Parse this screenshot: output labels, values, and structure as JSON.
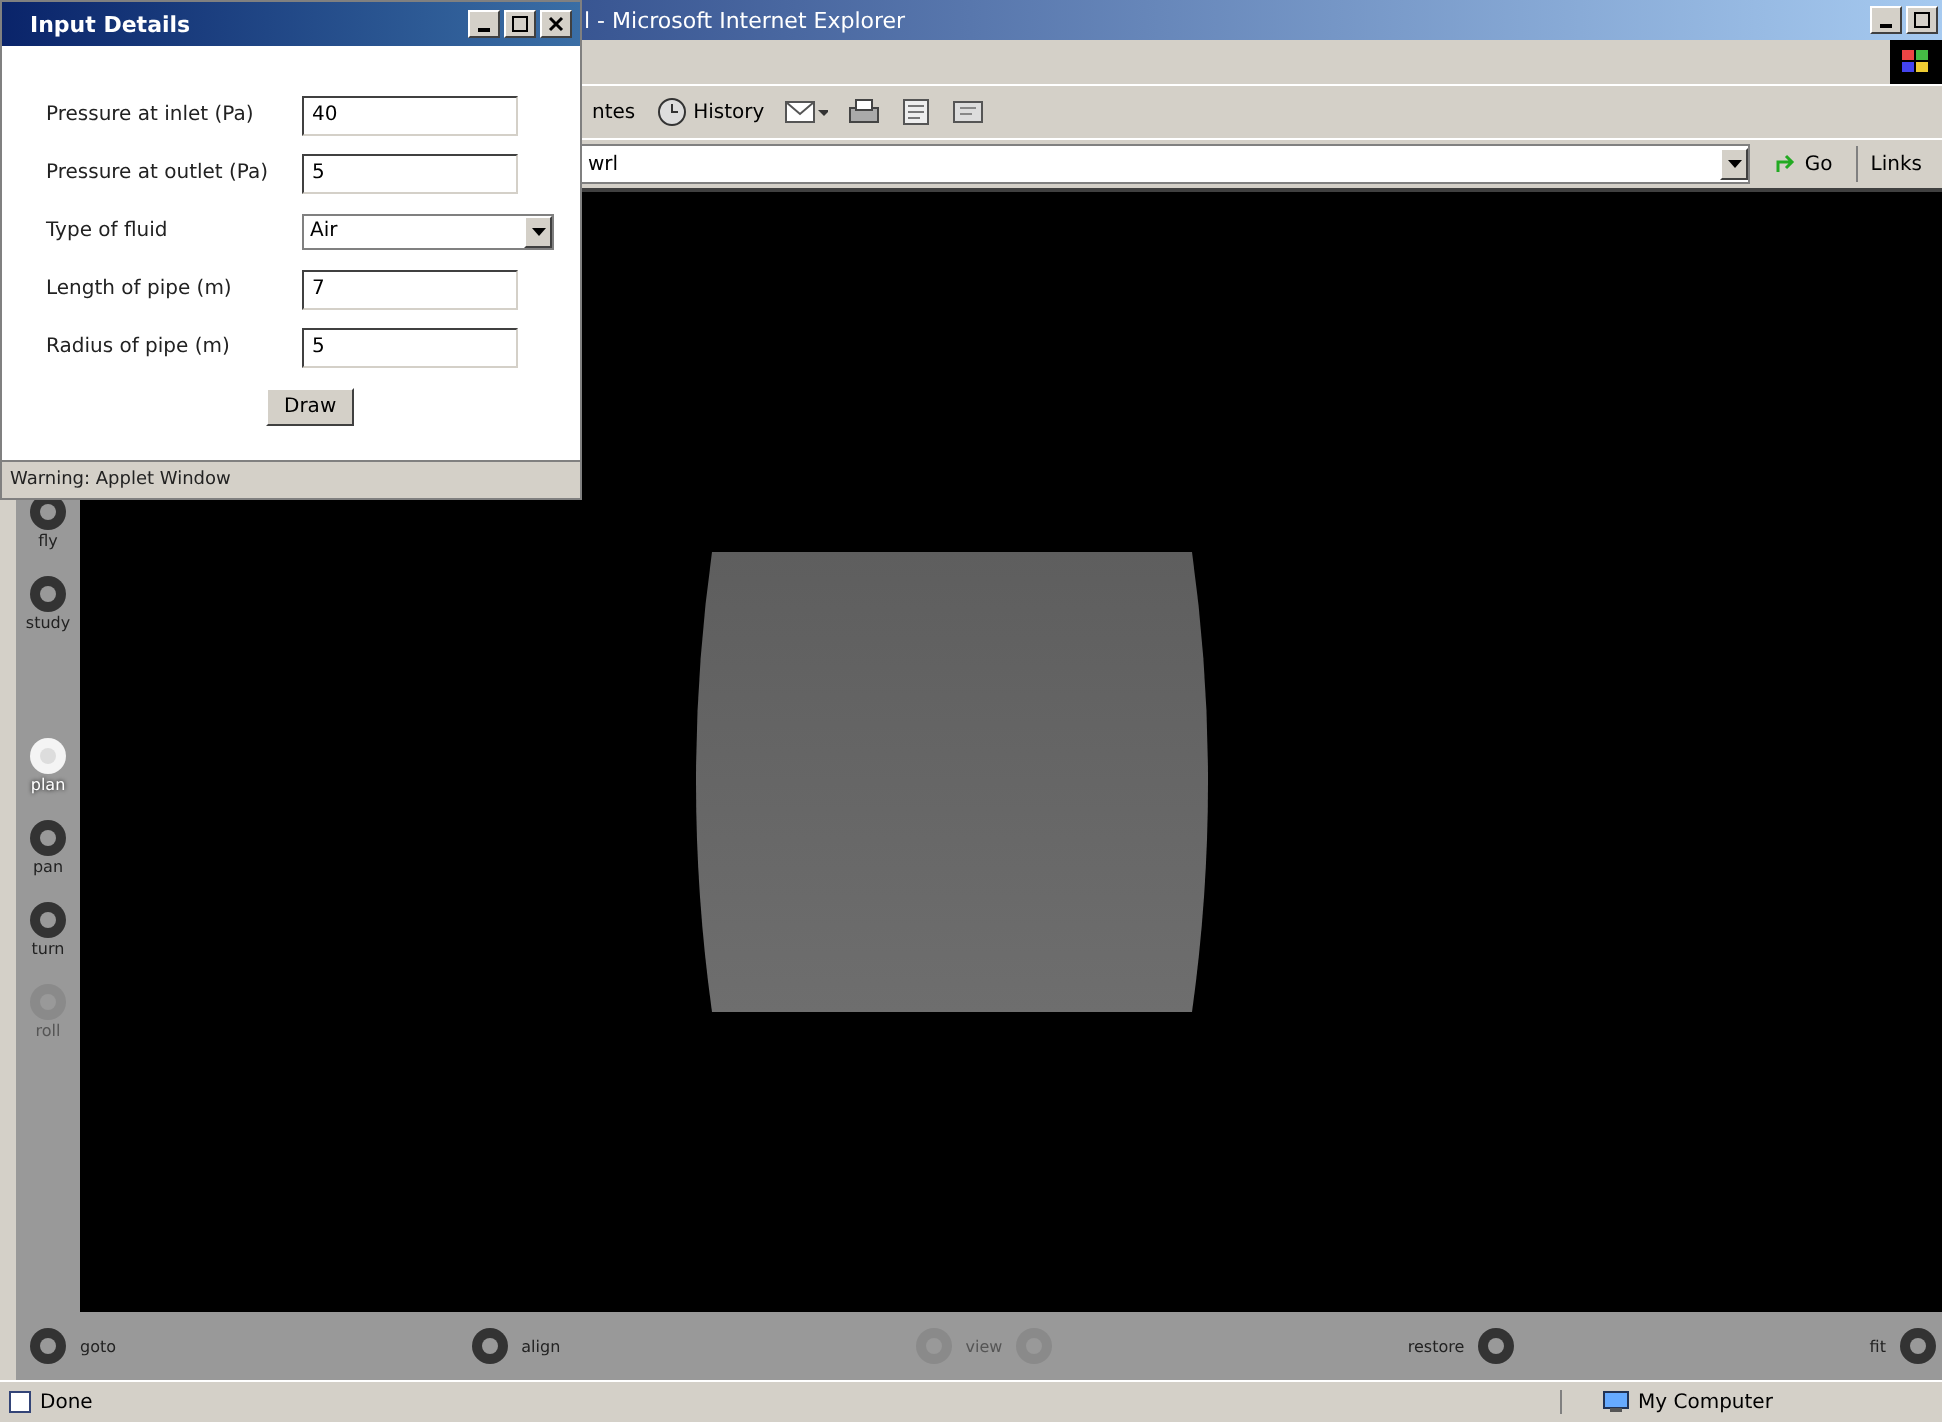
{
  "browser": {
    "title": "l - Microsoft Internet Explorer",
    "toolbar": [
      {
        "kind": "text",
        "label": "ntes"
      },
      {
        "kind": "history",
        "label": "History"
      }
    ],
    "address": "wrl",
    "go": "Go",
    "links": "Links"
  },
  "viewer": {
    "nav_buttons": [
      {
        "label": "fly",
        "selected": false,
        "disabled": false
      },
      {
        "label": "study",
        "selected": false,
        "disabled": false
      },
      {
        "label": "plan",
        "selected": true,
        "disabled": false
      },
      {
        "label": "pan",
        "selected": false,
        "disabled": false
      },
      {
        "label": "turn",
        "selected": false,
        "disabled": false
      },
      {
        "label": "roll",
        "selected": false,
        "disabled": true
      }
    ],
    "view_buttons": [
      {
        "label": "goto",
        "kind": "icon-left",
        "disabled": false
      },
      {
        "label": "align",
        "kind": "icon-left",
        "disabled": false
      },
      {
        "label": "view",
        "kind": "icons-both",
        "disabled": true
      },
      {
        "label": "restore",
        "kind": "icon-right",
        "disabled": false
      },
      {
        "label": "fit",
        "kind": "icon-right",
        "disabled": false
      }
    ]
  },
  "status_bar": {
    "text": "Done",
    "zone": "My Computer"
  },
  "dialog": {
    "title": "Input Details",
    "fields": [
      {
        "label": "Pressure at inlet (Pa)",
        "kind": "text",
        "value": "40"
      },
      {
        "label": "Pressure at outlet (Pa)",
        "kind": "text",
        "value": "5"
      },
      {
        "label": "Type of fluid",
        "kind": "select",
        "value": "Air"
      },
      {
        "label": "Length of pipe (m)",
        "kind": "text",
        "value": "7"
      },
      {
        "label": "Radius of pipe (m)",
        "kind": "text",
        "value": "5"
      }
    ],
    "button": "Draw",
    "warning": "Warning: Applet Window"
  }
}
